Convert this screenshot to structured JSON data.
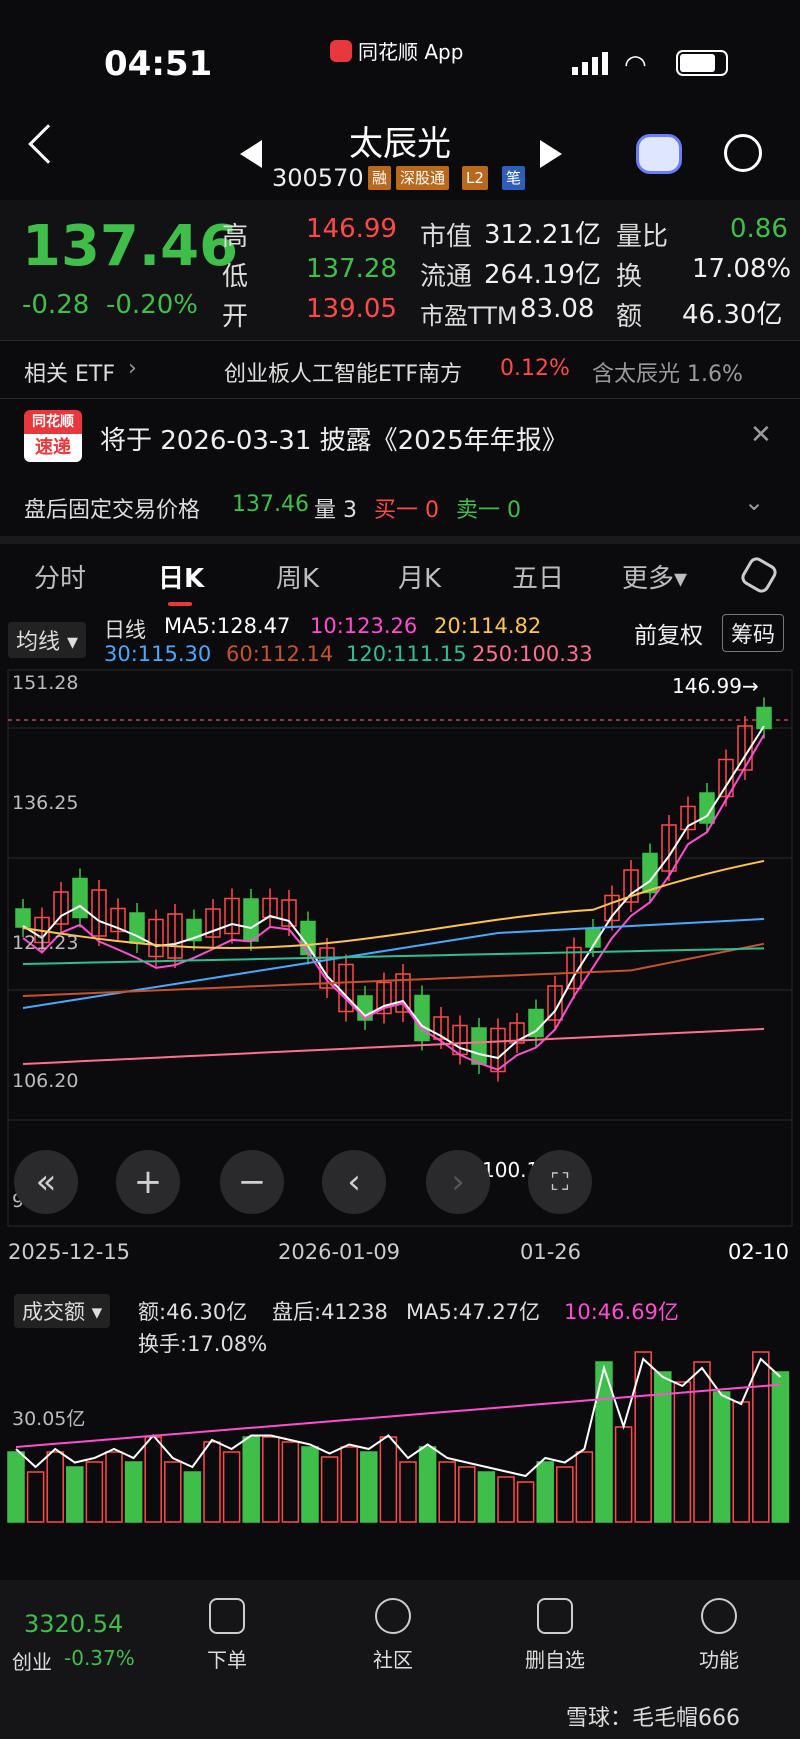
{
  "status": {
    "time": "04:51",
    "app": "同花顺 App"
  },
  "header": {
    "title": "太辰光",
    "code": "300570",
    "tags": [
      "融",
      "深股通",
      "L2",
      "笔"
    ]
  },
  "quote": {
    "price": "137.46",
    "change": "-0.28",
    "change_pct": "-0.20%",
    "high_label": "高",
    "high": "146.99",
    "low_label": "低",
    "low": "137.28",
    "open_label": "开",
    "open": "139.05",
    "mcap_label": "市值",
    "mcap": "312.21亿",
    "float_label": "流通",
    "float": "264.19亿",
    "pe_label": "市盈TTM",
    "pe": "83.08",
    "vr_label": "量比",
    "vr": "0.86",
    "turnover_label": "换",
    "turnover": "17.08%",
    "amount_label": "额",
    "amount": "46.30亿"
  },
  "etf": {
    "label": "相关 ETF",
    "name": "创业板人工智能ETF南方",
    "pct": "0.12%",
    "hold": "含太辰光  1.6%"
  },
  "notice": {
    "badge_top": "同花顺",
    "badge_bottom": "速递",
    "text": "将于 2026-03-31 披露《2025年年报》"
  },
  "afterhours": {
    "label": "盘后固定交易价格",
    "price": "137.46",
    "vol": "量 3",
    "buy": "买一 0",
    "sell": "卖一 0"
  },
  "tabs": [
    "分时",
    "日K",
    "周K",
    "月K",
    "五日",
    "更多▾"
  ],
  "kline": {
    "ma_btn": "均线 ▾",
    "period": "日线",
    "ma5": "MA5:128.47",
    "ma10": "10:123.26",
    "ma20": "20:114.82",
    "ma30": "30:115.30",
    "ma60": "60:112.14",
    "ma120": "120:111.15",
    "ma250": "250:100.33",
    "adjust": "前复权",
    "chips": "筹码",
    "y_ticks": [
      "151.28",
      "136.25",
      "121.23",
      "106.20",
      "91.17"
    ],
    "high_mark": "146.99→",
    "low_mark": "100.18",
    "dates": [
      "2025-12-15",
      "2026-01-09",
      "01-26",
      "02-10"
    ]
  },
  "volume": {
    "btn": "成交额 ▾",
    "amount": "额:46.30亿",
    "after": "盘后:41238",
    "ma5": "MA5:47.27亿",
    "ma10": "10:46.69亿",
    "turnover": "换手:17.08%",
    "y_tick": "30.05亿"
  },
  "colors": {
    "up": "#ff4a4a",
    "down": "#3fbf4a",
    "ma5": "#ffffff",
    "ma10": "#ff4fd1",
    "ma20": "#ffc44d",
    "ma30": "#4aa8ff",
    "ma60": "#c8522a",
    "ma120": "#2fbf8f",
    "ma250": "#ff6f8f"
  },
  "bottom_nav": {
    "index_value": "3320.54",
    "index_name": "创业",
    "index_pct": "-0.37%",
    "items": [
      "下单",
      "社区",
      "删自选",
      "功能"
    ],
    "watermark": "雪球：毛毛帽666"
  }
}
